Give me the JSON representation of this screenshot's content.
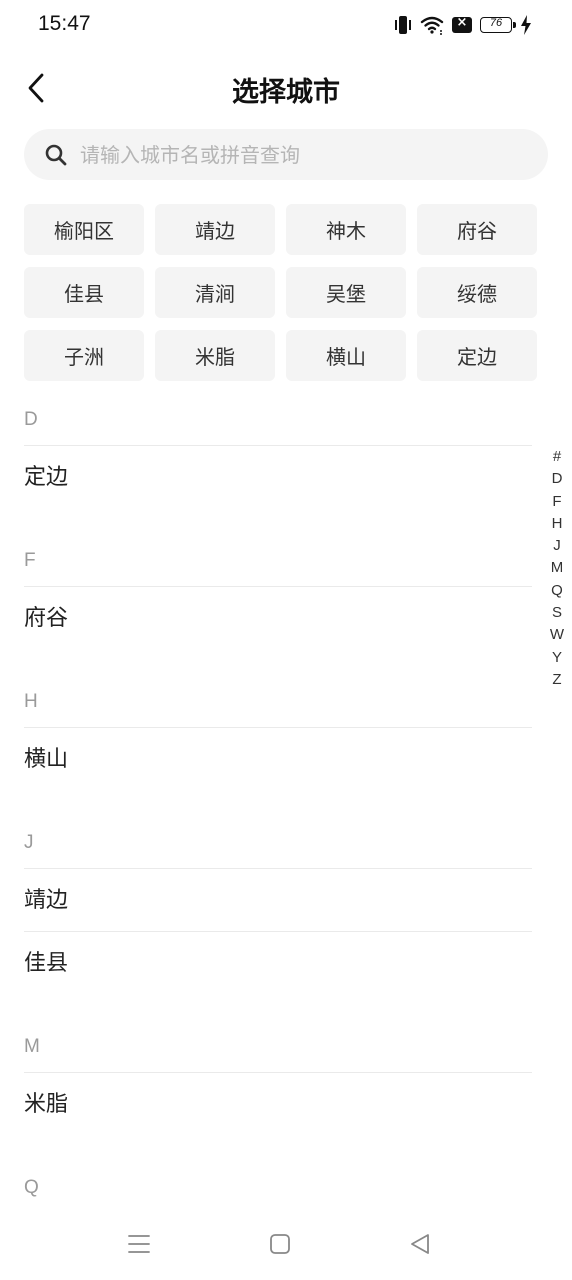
{
  "status_bar": {
    "time": "15:47",
    "battery_level": "76",
    "icons": [
      "vibrate-icon",
      "wifi-icon",
      "no-sim-icon",
      "battery-icon",
      "charging-bolt-icon"
    ]
  },
  "header": {
    "title": "选择城市",
    "back_icon": "chevron-left-icon"
  },
  "search": {
    "placeholder": "请输入城市名或拼音查询",
    "icon": "search-icon"
  },
  "hot_cities": [
    "榆阳区",
    "靖边",
    "神木",
    "府谷",
    "佳县",
    "清涧",
    "吴堡",
    "绥德",
    "子洲",
    "米脂",
    "横山",
    "定边"
  ],
  "sections": [
    {
      "letter": "D",
      "cities": [
        "定边"
      ]
    },
    {
      "letter": "F",
      "cities": [
        "府谷"
      ]
    },
    {
      "letter": "H",
      "cities": [
        "横山"
      ]
    },
    {
      "letter": "J",
      "cities": [
        "靖边",
        "佳县"
      ]
    },
    {
      "letter": "M",
      "cities": [
        "米脂"
      ]
    },
    {
      "letter": "Q",
      "cities": []
    }
  ],
  "index_letters": [
    "#",
    "D",
    "F",
    "H",
    "J",
    "M",
    "Q",
    "S",
    "W",
    "Y",
    "Z"
  ],
  "nav_bar": {
    "icons": [
      "menu-icon",
      "home-square-icon",
      "back-triangle-icon"
    ]
  }
}
